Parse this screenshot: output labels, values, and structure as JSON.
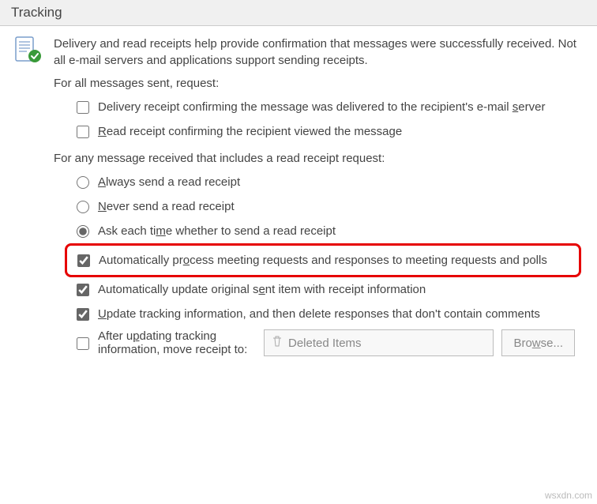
{
  "header": {
    "title": "Tracking"
  },
  "intro": "Delivery and read receipts help provide confirmation that messages were successfully received. Not all e-mail servers and applications support sending receipts.",
  "sent_section_label": "For all messages sent, request:",
  "delivery_receipt": {
    "pre": "Delivery receipt confirming the message was delivered to the recipient's e-mail ",
    "u": "s",
    "post": "erver"
  },
  "read_receipt": {
    "u": "R",
    "post": "ead receipt confirming the recipient viewed the message"
  },
  "received_section_label": "For any message received that includes a read receipt request:",
  "always": {
    "u": "A",
    "post": "lways send a read receipt"
  },
  "never": {
    "u": "N",
    "post": "ever send a read receipt"
  },
  "ask": {
    "pre": "Ask each ti",
    "u": "m",
    "post": "e whether to send a read receipt"
  },
  "auto_process": {
    "pre": "Automatically pr",
    "u": "o",
    "post": "cess meeting requests and responses to meeting requests and polls"
  },
  "auto_update": {
    "pre": "Automatically update original s",
    "u": "e",
    "post": "nt item with receipt information"
  },
  "update_delete": {
    "u": "U",
    "post": "pdate tracking information, and then delete responses that don't contain comments"
  },
  "after_updating": {
    "pre": "After u",
    "u": "p",
    "post": "dating tracking information, move receipt to:"
  },
  "deleted_items": "Deleted Items",
  "browse": {
    "pre": "Bro",
    "u": "w",
    "post": "se..."
  },
  "watermark": "wsxdn.com"
}
